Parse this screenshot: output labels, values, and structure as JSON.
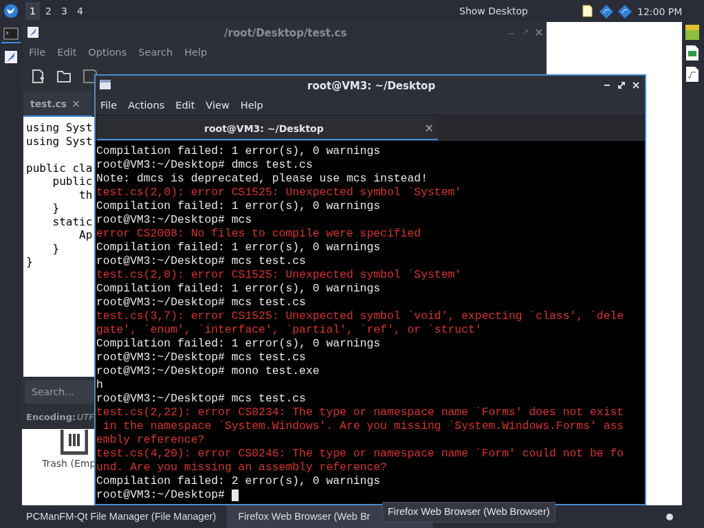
{
  "top_panel": {
    "workspaces": [
      {
        "label": "1",
        "selected": true
      },
      {
        "label": "2",
        "selected": false
      },
      {
        "label": "3",
        "selected": false
      },
      {
        "label": "4",
        "selected": false
      }
    ],
    "show_desktop": "Show Desktop",
    "clock": "12:00 PM"
  },
  "editor": {
    "title": "/root/Desktop/test.cs",
    "menu": [
      "File",
      "Edit",
      "Options",
      "Search",
      "Help"
    ],
    "tab": "test.cs",
    "tab_close": "×",
    "code": [
      [
        "using Syst",
        "using Syst"
      ],
      [
        "public cla",
        "    public",
        "        th",
        "    }",
        "    static",
        "        Ap",
        "    }",
        "}"
      ]
    ],
    "search": {
      "placeholder": "Search..."
    },
    "encoding_label": "Encoding:",
    "encoding_value": "UTF"
  },
  "desktop": {
    "trash_label": "Trash (Emp"
  },
  "terminal": {
    "title": "root@VM3: ~/Desktop",
    "menu": [
      "File",
      "Actions",
      "Edit",
      "View",
      "Help"
    ],
    "tab": "root@VM3: ~/Desktop",
    "tab_close": "×",
    "lines": [
      {
        "kind": "output",
        "text": "Compilation failed: 1 error(s), 0 warnings"
      },
      {
        "kind": "output",
        "text": "root@VM3:~/Desktop# dmcs test.cs"
      },
      {
        "kind": "output",
        "text": "Note: dmcs is deprecated, please use mcs instead!"
      },
      {
        "kind": "error",
        "text": "test.cs(2,0): error CS1525: Unexpected symbol `System'"
      },
      {
        "kind": "output",
        "text": "Compilation failed: 1 error(s), 0 warnings"
      },
      {
        "kind": "output",
        "text": "root@VM3:~/Desktop# mcs"
      },
      {
        "kind": "error",
        "text": "error CS2008: No files to compile were specified"
      },
      {
        "kind": "output",
        "text": "Compilation failed: 1 error(s), 0 warnings"
      },
      {
        "kind": "output",
        "text": "root@VM3:~/Desktop# mcs test.cs"
      },
      {
        "kind": "error",
        "text": "test.cs(2,0): error CS1525: Unexpected symbol `System'"
      },
      {
        "kind": "output",
        "text": "Compilation failed: 1 error(s), 0 warnings"
      },
      {
        "kind": "output",
        "text": "root@VM3:~/Desktop# mcs test.cs"
      },
      {
        "kind": "error",
        "text": "test.cs(3,7): error CS1525: Unexpected symbol `void', expecting `class', `dele"
      },
      {
        "kind": "error",
        "text": "gate', `enum', `interface', `partial', `ref', or `struct'"
      },
      {
        "kind": "output",
        "text": "Compilation failed: 1 error(s), 0 warnings"
      },
      {
        "kind": "output",
        "text": "root@VM3:~/Desktop# mcs test.cs"
      },
      {
        "kind": "output",
        "text": "root@VM3:~/Desktop# mono test.exe"
      },
      {
        "kind": "output",
        "text": "h"
      },
      {
        "kind": "output",
        "text": "root@VM3:~/Desktop# mcs test.cs"
      },
      {
        "kind": "error",
        "text": "test.cs(2,22): error CS0234: The type or namespace name `Forms' does not exist"
      },
      {
        "kind": "error",
        "text": " in the namespace `System.Windows'. Are you missing `System.Windows.Forms' ass"
      },
      {
        "kind": "error",
        "text": "embly reference?"
      },
      {
        "kind": "error",
        "text": "test.cs(4,20): error CS0246: The type or namespace name `Form' could not be fo"
      },
      {
        "kind": "error",
        "text": "und. Are you missing an assembly reference?"
      },
      {
        "kind": "output",
        "text": "Compilation failed: 2 error(s), 0 warnings"
      },
      {
        "kind": "prompt",
        "text": "root@VM3:~/Desktop# "
      }
    ]
  },
  "taskbar": {
    "items": [
      {
        "label": "PCManFM-Qt File Manager (File Manager)",
        "selected": false
      },
      {
        "label": "Firefox Web Browser (Web Br",
        "selected": true
      }
    ],
    "tooltip": "Firefox Web Browser (Web Browser)"
  }
}
